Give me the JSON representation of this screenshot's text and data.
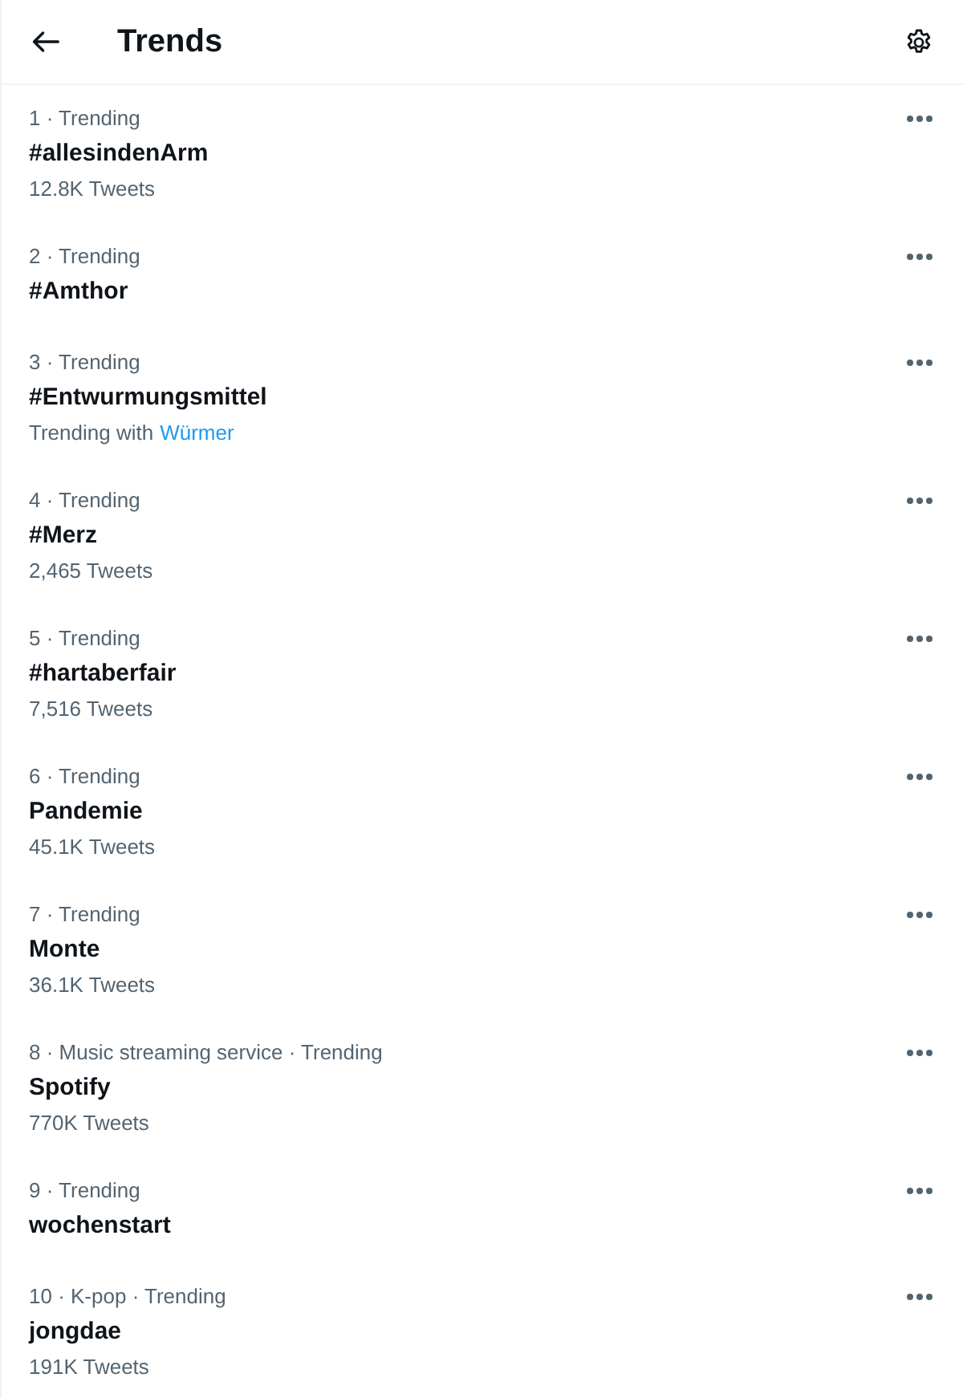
{
  "header": {
    "title": "Trends"
  },
  "trends": [
    {
      "context": "1 · Trending",
      "name": "#allesindenArm",
      "detail": {
        "kind": "count",
        "text": "12.8K Tweets"
      }
    },
    {
      "context": "2 · Trending",
      "name": "#Amthor"
    },
    {
      "context": "3 · Trending",
      "name": "#Entwurmungsmittel",
      "detail": {
        "kind": "related",
        "label": "Trending with",
        "link": "Würmer"
      }
    },
    {
      "context": "4 · Trending",
      "name": "#Merz",
      "detail": {
        "kind": "count",
        "text": "2,465 Tweets"
      }
    },
    {
      "context": "5 · Trending",
      "name": "#hartaberfair",
      "detail": {
        "kind": "count",
        "text": "7,516 Tweets"
      }
    },
    {
      "context": "6 · Trending",
      "name": "Pandemie",
      "detail": {
        "kind": "count",
        "text": "45.1K Tweets"
      }
    },
    {
      "context": "7 · Trending",
      "name": "Monte",
      "detail": {
        "kind": "count",
        "text": "36.1K Tweets"
      }
    },
    {
      "context": "8 · Music streaming service · Trending",
      "name": "Spotify",
      "detail": {
        "kind": "count",
        "text": "770K Tweets"
      }
    },
    {
      "context": "9 · Trending",
      "name": "wochenstart"
    },
    {
      "context": "10 · K-pop · Trending",
      "name": "jongdae",
      "detail": {
        "kind": "count",
        "text": "191K Tweets"
      }
    }
  ]
}
